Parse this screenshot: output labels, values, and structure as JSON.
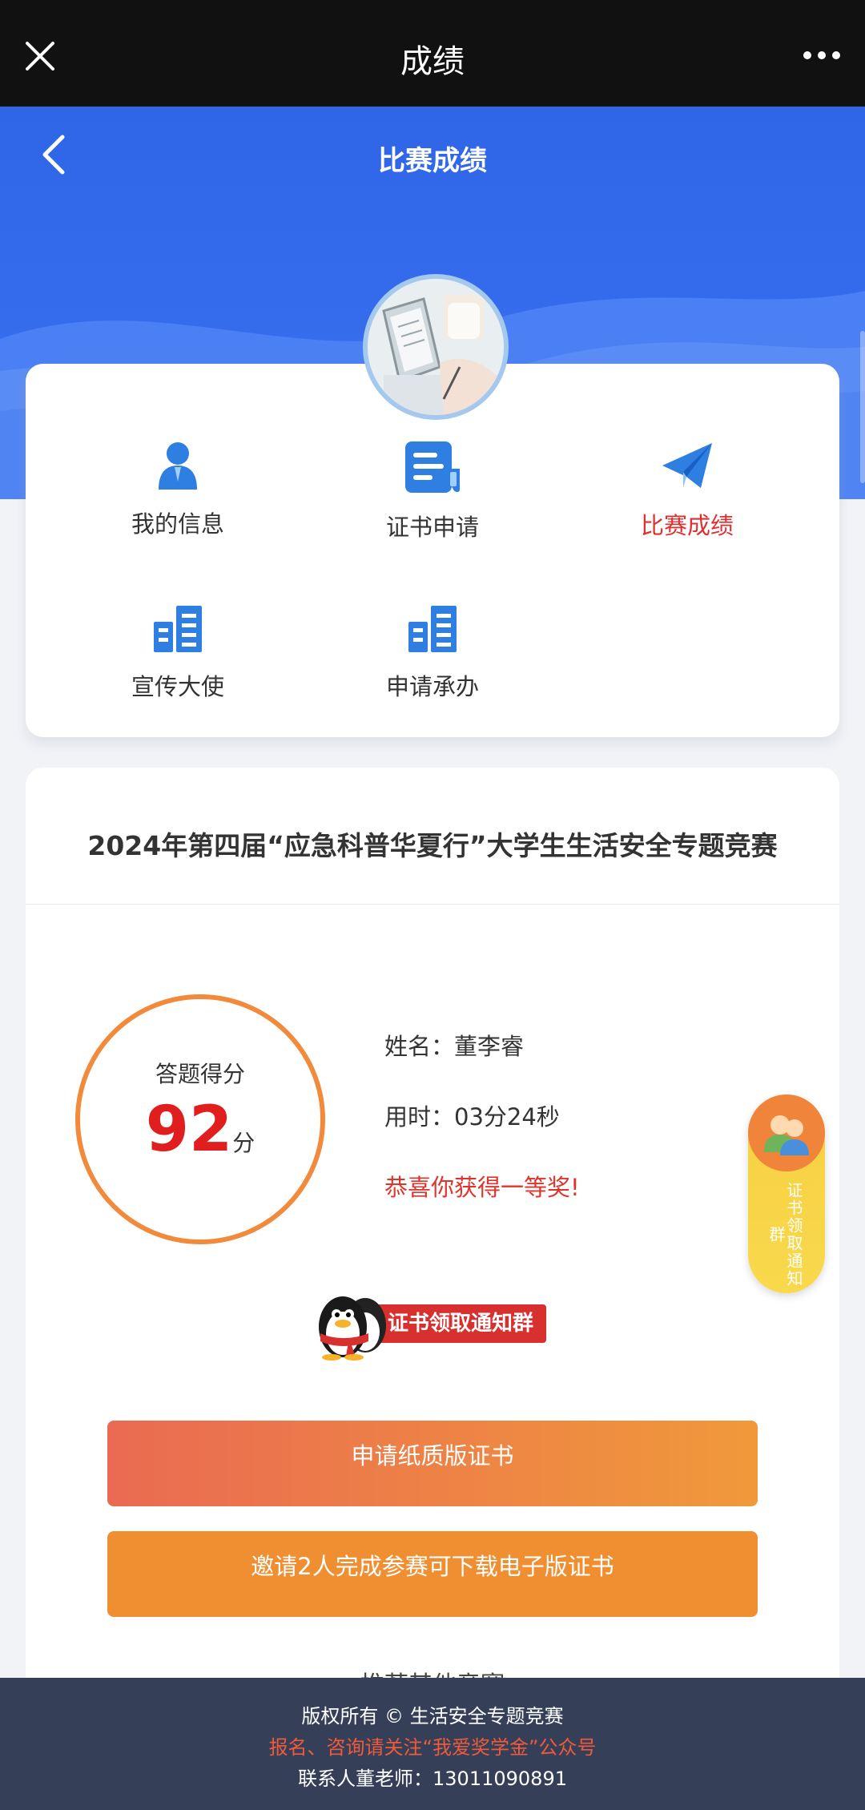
{
  "topbar": {
    "title": "成绩",
    "close_icon": "close-icon",
    "more_icon": "more-icon"
  },
  "header": {
    "title": "比赛成绩",
    "back_icon": "back-icon"
  },
  "menu": {
    "items": [
      {
        "label": "我的信息",
        "icon": "user-icon",
        "active": false
      },
      {
        "label": "证书申请",
        "icon": "certificate-icon",
        "active": false
      },
      {
        "label": "比赛成绩",
        "icon": "paper-plane-icon",
        "active": true
      },
      {
        "label": "宣传大使",
        "icon": "building-icon",
        "active": false
      },
      {
        "label": "申请承办",
        "icon": "building-icon",
        "active": false
      }
    ]
  },
  "competition": {
    "title": "2024年第四届“应急科普华夏行”大学生生活安全专题竞赛"
  },
  "score": {
    "caption": "答题得分",
    "value": "92",
    "unit": "分",
    "name": "姓名：董李睿",
    "time": "用时：03分24秒",
    "award": "恭喜你获得一等奖!"
  },
  "qq_group": {
    "label": "证书领取通知群"
  },
  "buttons": {
    "paper": "申请纸质版证书",
    "invite": "邀请2人完成参赛可下载电子版证书"
  },
  "peek_text": "推荐其他竞赛",
  "side_float": {
    "text": "证书领取通知群"
  },
  "footer": {
    "copyright": "版权所有 © 生活安全专题竞赛",
    "notice": "报名、咨询请关注“我爱奖学金”公众号",
    "contact": "联系人董老师：13011090891"
  },
  "colors": {
    "primary_blue": "#2f66e8",
    "accent_red": "#e01e1e",
    "orange": "#f08f32",
    "footer_bg": "#363f58"
  }
}
